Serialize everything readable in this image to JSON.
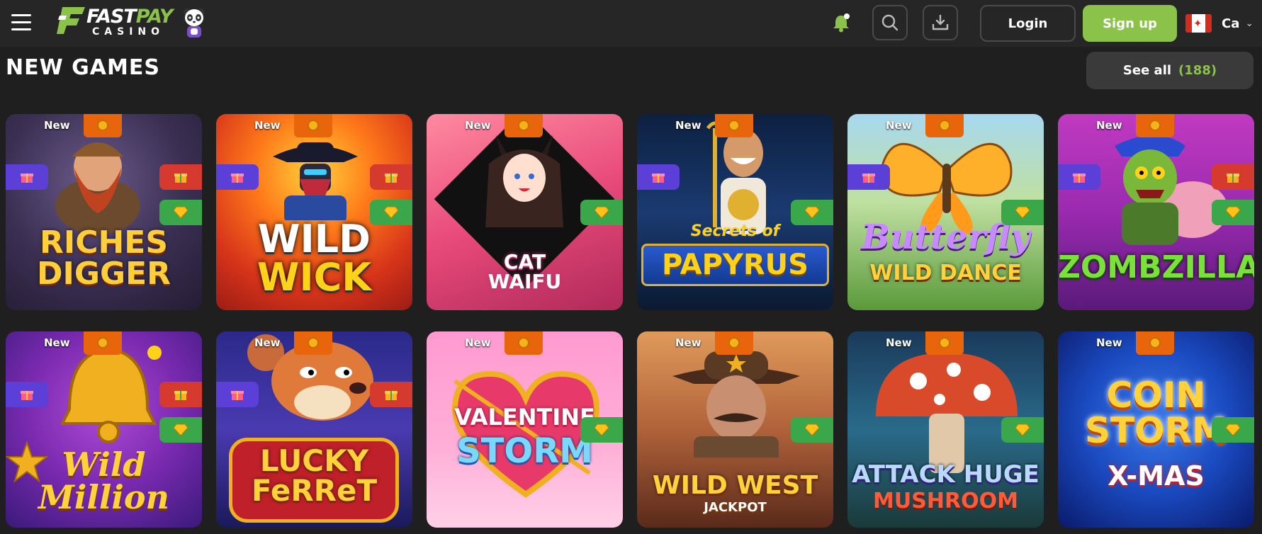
{
  "header": {
    "logo_text_1": "FAST",
    "logo_text_pay": "PAY",
    "logo_text_2": "CASINO",
    "login_label": "Login",
    "signup_label": "Sign up",
    "language_code": "Ca",
    "icons": [
      "menu-icon",
      "bell-icon",
      "search-icon",
      "download-icon",
      "canada-flag-icon",
      "chevron-down-icon"
    ]
  },
  "section": {
    "title": "NEW GAMES",
    "see_all_label": "See all",
    "see_all_count": "(188)"
  },
  "colors": {
    "accent": "#8bc34a",
    "background": "#1f1f1f",
    "header": "#262626",
    "badge_coin": "#e8650c",
    "badge_gift_left": "#5b3fd6",
    "badge_gift_right": "#d63a2f",
    "badge_gem": "#3aa84a"
  },
  "games": [
    {
      "title_1": "RICHES",
      "title_2": "DIGGER",
      "badge": "New",
      "gift_left": true,
      "gift_right": true,
      "gem": true
    },
    {
      "title_1": "WILD",
      "title_2": "WICK",
      "badge": "New",
      "gift_left": true,
      "gift_right": true,
      "gem": true
    },
    {
      "title_1": "CAT",
      "title_2": "WAIFU",
      "badge": "New",
      "gift_left": false,
      "gift_right": false,
      "gem": true
    },
    {
      "title_1": "Secrets of",
      "title_2": "PAPYRUS",
      "badge": "New",
      "gift_left": true,
      "gift_right": false,
      "gem": true
    },
    {
      "title_1": "Butterfly",
      "title_2": "WILD DANCE",
      "badge": "New",
      "gift_left": true,
      "gift_right": false,
      "gem": true
    },
    {
      "title_1": "ZOMBZILLA",
      "title_2": "",
      "badge": "New",
      "gift_left": true,
      "gift_right": true,
      "gem": true
    },
    {
      "title_1": "Wild",
      "title_2": "Million",
      "badge": "New",
      "gift_left": true,
      "gift_right": true,
      "gem": true
    },
    {
      "title_1": "LUCKY",
      "title_2": "FeRReT",
      "badge": "New",
      "gift_left": true,
      "gift_right": true,
      "gem": false
    },
    {
      "title_1": "VALENTINE",
      "title_2": "STORM",
      "badge": "New",
      "gift_left": false,
      "gift_right": false,
      "gem": true
    },
    {
      "title_1": "WILD WEST",
      "title_2": "JACKPOT",
      "badge": "New",
      "gift_left": false,
      "gift_right": false,
      "gem": true
    },
    {
      "title_1": "ATTACK HUGE",
      "title_2": "MUSHROOM",
      "badge": "New",
      "gift_left": false,
      "gift_right": false,
      "gem": true
    },
    {
      "title_1": "COIN STORM",
      "title_2": "X-MAS",
      "badge": "New",
      "gift_left": false,
      "gift_right": false,
      "gem": true
    }
  ]
}
